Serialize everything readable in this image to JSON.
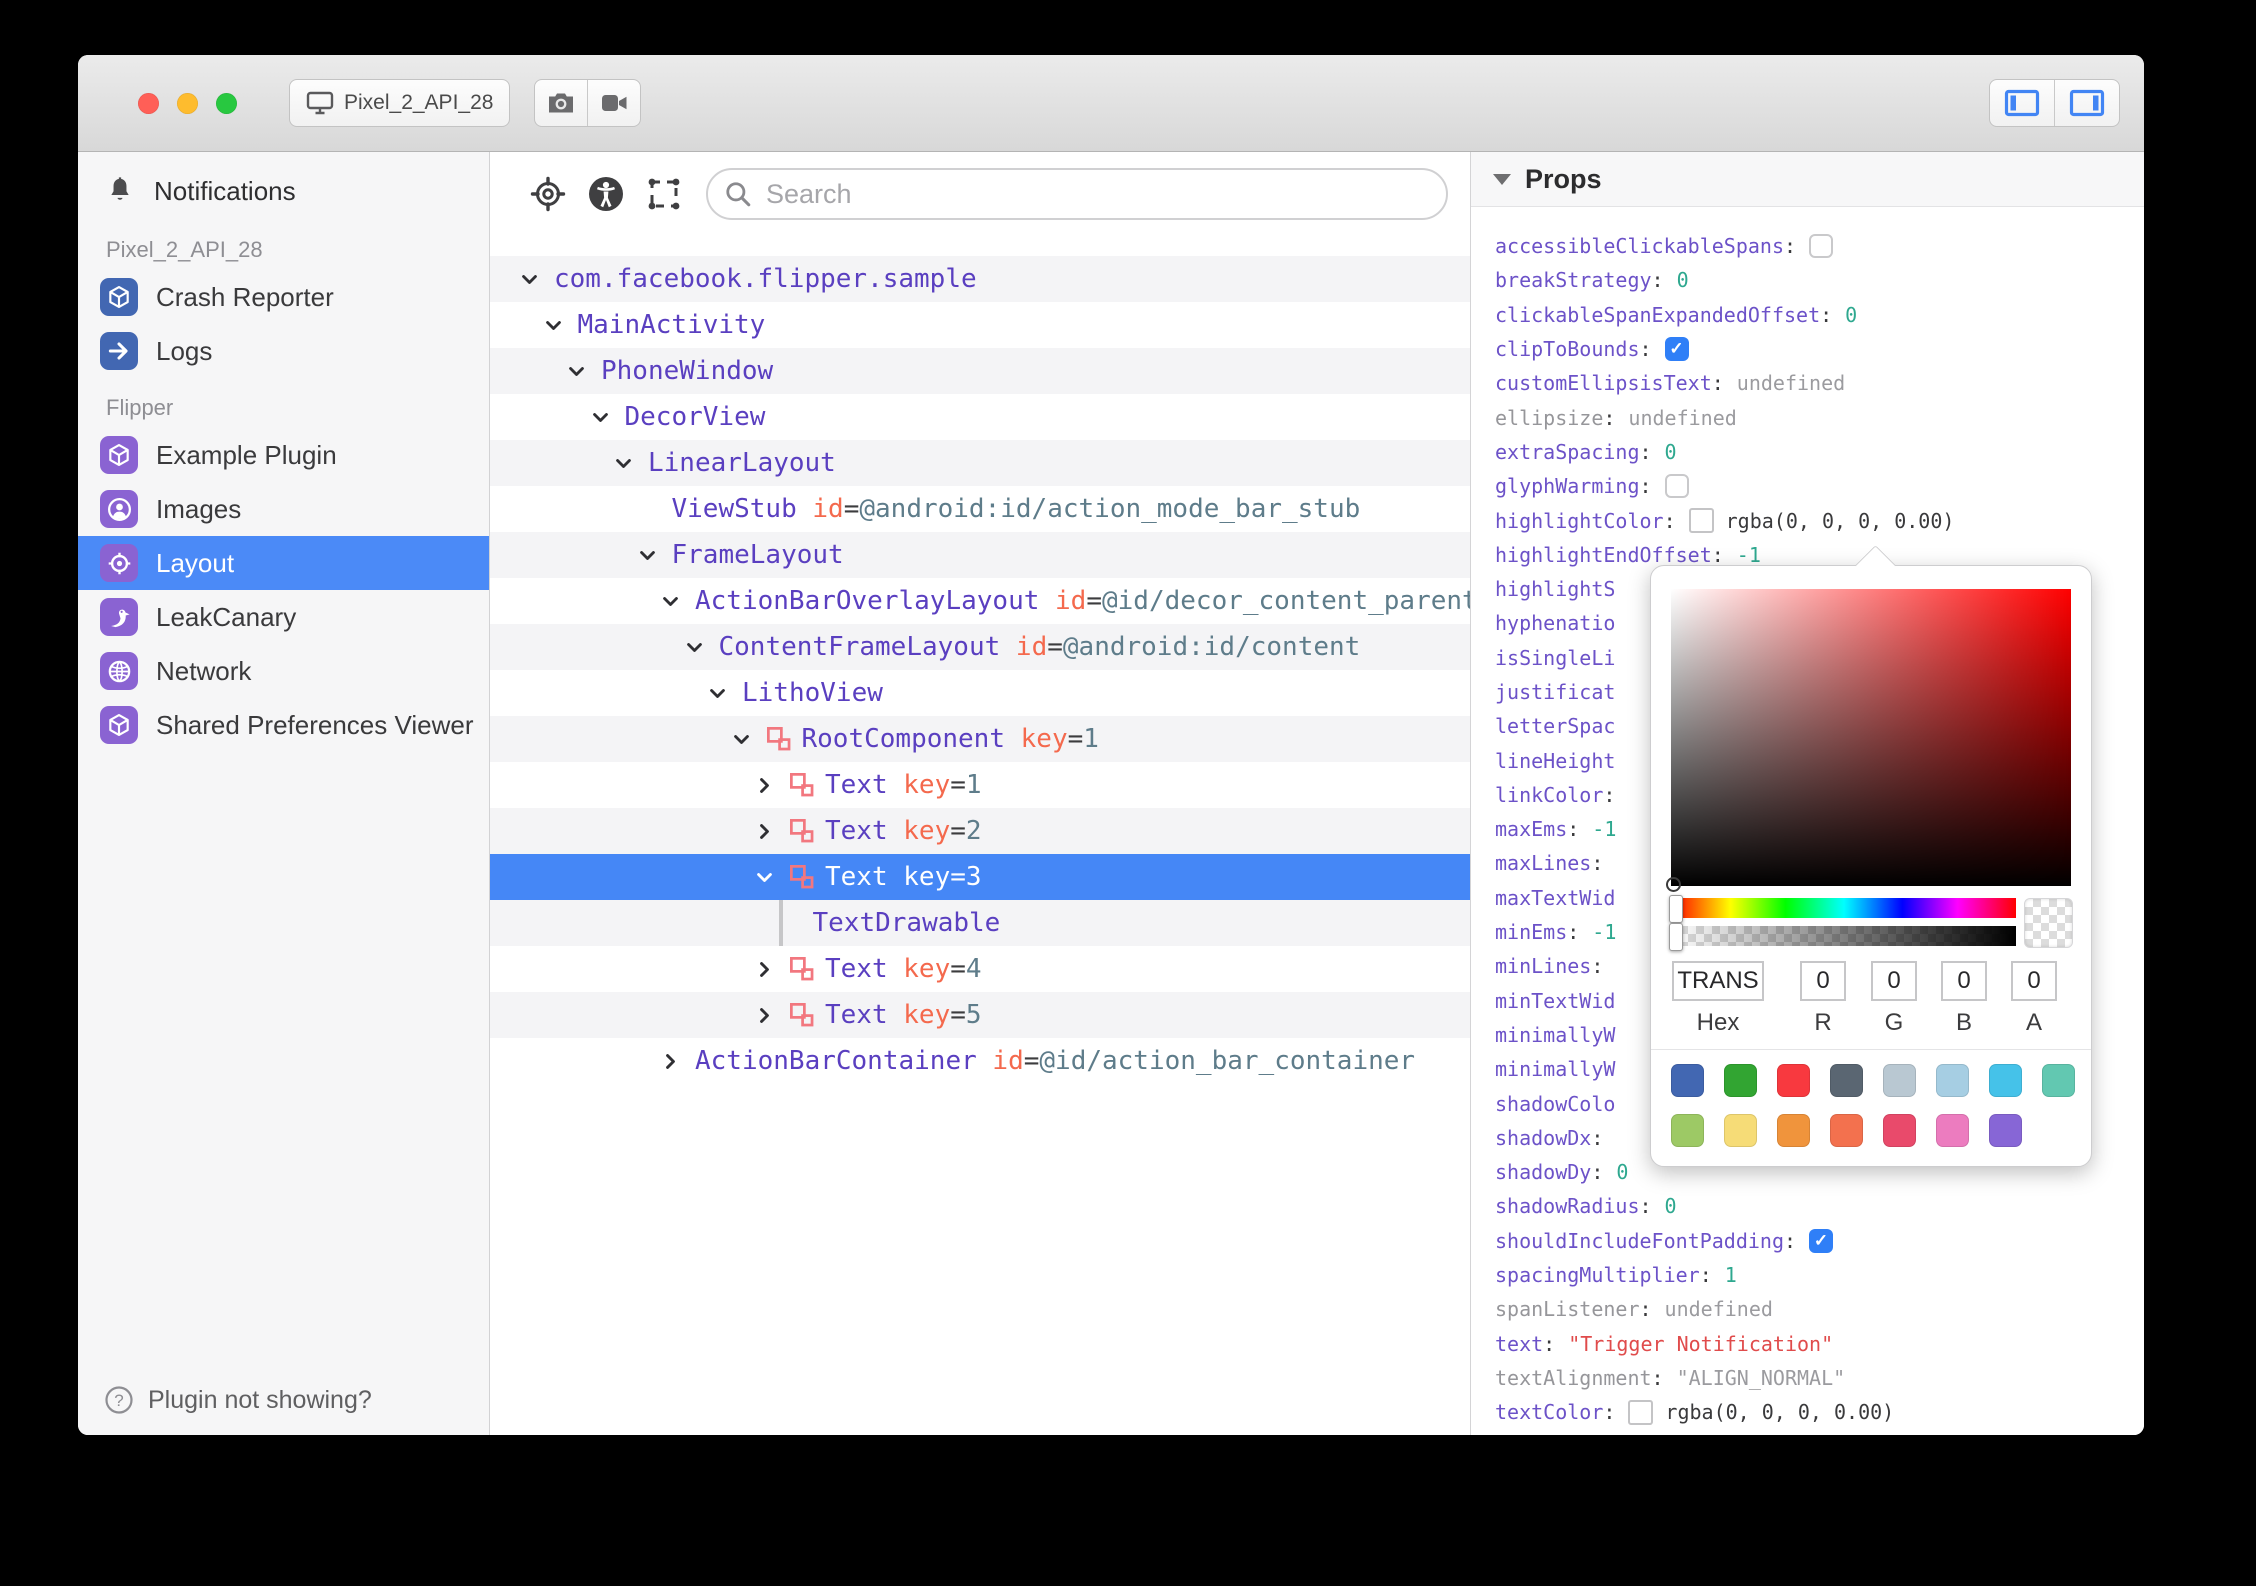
{
  "titlebar": {
    "device": "Pixel_2_API_28"
  },
  "sidebar": {
    "notifications": "Notifications",
    "sections": [
      {
        "header": "Pixel_2_API_28",
        "items": [
          {
            "label": "Crash Reporter",
            "icon": "cube",
            "color": "#4267B2"
          },
          {
            "label": "Logs",
            "icon": "arrow",
            "color": "#4267B2"
          }
        ]
      },
      {
        "header": "Flipper",
        "items": [
          {
            "label": "Example Plugin",
            "icon": "cube",
            "color": "#8A63D2"
          },
          {
            "label": "Images",
            "icon": "person",
            "color": "#8A63D2"
          },
          {
            "label": "Layout",
            "icon": "target",
            "color": "#8A63D2",
            "selected": true
          },
          {
            "label": "LeakCanary",
            "icon": "bird",
            "color": "#8A63D2"
          },
          {
            "label": "Network",
            "icon": "globe",
            "color": "#8A63D2"
          },
          {
            "label": "Shared Preferences Viewer",
            "icon": "cube",
            "color": "#8A63D2"
          }
        ]
      }
    ],
    "help": "Plugin not showing?"
  },
  "toolbar": {
    "search_placeholder": "Search"
  },
  "tree": {
    "rows": [
      {
        "level": 0,
        "chev": "down",
        "name": "com.facebook.flipper.sample"
      },
      {
        "level": 1,
        "chev": "down",
        "name": "MainActivity"
      },
      {
        "level": 2,
        "chev": "down",
        "name": "PhoneWindow"
      },
      {
        "level": 3,
        "chev": "down",
        "name": "DecorView"
      },
      {
        "level": 4,
        "chev": "down",
        "name": "LinearLayout"
      },
      {
        "level": 5,
        "chev": "none",
        "name": "ViewStub",
        "attrs": [
          {
            "n": "id",
            "v": "@android:id/action_mode_bar_stub"
          }
        ]
      },
      {
        "level": 5,
        "chev": "down",
        "name": "FrameLayout"
      },
      {
        "level": 6,
        "chev": "down",
        "name": "ActionBarOverlayLayout",
        "attrs": [
          {
            "n": "id",
            "v": "@id/decor_content_parent"
          }
        ]
      },
      {
        "level": 7,
        "chev": "down",
        "name": "ContentFrameLayout",
        "attrs": [
          {
            "n": "id",
            "v": "@android:id/content"
          }
        ]
      },
      {
        "level": 8,
        "chev": "down",
        "name": "LithoView"
      },
      {
        "level": 9,
        "chev": "down",
        "litho": true,
        "name": "RootComponent",
        "attrs": [
          {
            "n": "key",
            "v": "1"
          }
        ]
      },
      {
        "level": 10,
        "chev": "right",
        "litho": true,
        "name": "Text",
        "attrs": [
          {
            "n": "key",
            "v": "1"
          }
        ]
      },
      {
        "level": 10,
        "chev": "right",
        "litho": true,
        "name": "Text",
        "attrs": [
          {
            "n": "key",
            "v": "2"
          }
        ]
      },
      {
        "level": 10,
        "chev": "down",
        "litho": true,
        "name": "Text",
        "attrs": [
          {
            "n": "key",
            "v": "3"
          }
        ],
        "selected": true
      },
      {
        "level": 11,
        "chev": "bar",
        "name": "TextDrawable"
      },
      {
        "level": 10,
        "chev": "right",
        "litho": true,
        "name": "Text",
        "attrs": [
          {
            "n": "key",
            "v": "4"
          }
        ]
      },
      {
        "level": 10,
        "chev": "right",
        "litho": true,
        "name": "Text",
        "attrs": [
          {
            "n": "key",
            "v": "5"
          }
        ]
      },
      {
        "level": 6,
        "chev": "right",
        "name": "ActionBarContainer",
        "attrs": [
          {
            "n": "id",
            "v": "@id/action_bar_container"
          }
        ]
      }
    ]
  },
  "props": {
    "title": "Props",
    "rows": [
      {
        "key": "accessibleClickableSpans",
        "type": "checkbox",
        "checked": false
      },
      {
        "key": "breakStrategy",
        "type": "number",
        "value": "0"
      },
      {
        "key": "clickableSpanExpandedOffset",
        "type": "number",
        "value": "0"
      },
      {
        "key": "clipToBounds",
        "type": "checkbox",
        "checked": true
      },
      {
        "key": "customEllipsisText",
        "type": "gray",
        "value": "undefined"
      },
      {
        "key": "ellipsize",
        "type": "gray",
        "value": "undefined",
        "grayKey": true
      },
      {
        "key": "extraSpacing",
        "type": "number",
        "value": "0"
      },
      {
        "key": "glyphWarming",
        "type": "checkbox",
        "checked": false
      },
      {
        "key": "highlightColor",
        "type": "color",
        "value": "rgba(0, 0, 0, 0.00)"
      },
      {
        "key": "highlightEndOffset",
        "type": "number",
        "value": "-1"
      },
      {
        "key": "highlightS",
        "type": "trunc"
      },
      {
        "key": "hyphenatio",
        "type": "trunc"
      },
      {
        "key": "isSingleLi",
        "type": "trunc"
      },
      {
        "key": "justificat",
        "type": "trunc"
      },
      {
        "key": "letterSpac",
        "type": "trunc"
      },
      {
        "key": "lineHeight",
        "type": "trunc"
      },
      {
        "key": "linkColor",
        "type": "number",
        "value": ""
      },
      {
        "key": "maxEms",
        "type": "number",
        "value": "-1"
      },
      {
        "key": "maxLines",
        "type": "number",
        "value": ""
      },
      {
        "key": "maxTextWid",
        "type": "trunc"
      },
      {
        "key": "minEms",
        "type": "number",
        "value": "-1"
      },
      {
        "key": "minLines",
        "type": "number",
        "value": ""
      },
      {
        "key": "minTextWid",
        "type": "trunc"
      },
      {
        "key": "minimallyW",
        "type": "trunc"
      },
      {
        "key": "minimallyW",
        "type": "trunc"
      },
      {
        "key": "shadowColo",
        "type": "trunc"
      },
      {
        "key": "shadowDx",
        "type": "number",
        "value": ""
      },
      {
        "key": "shadowDy",
        "type": "number",
        "value": "0"
      },
      {
        "key": "shadowRadius",
        "type": "number",
        "value": "0"
      },
      {
        "key": "shouldIncludeFontPadding",
        "type": "checkbox",
        "checked": true
      },
      {
        "key": "spacingMultiplier",
        "type": "number",
        "value": "1"
      },
      {
        "key": "spanListener",
        "type": "gray",
        "value": "undefined",
        "grayKey": true
      },
      {
        "key": "text",
        "type": "string",
        "value": "\"Trigger Notification\""
      },
      {
        "key": "textAlignment",
        "type": "graystr",
        "value": "\"ALIGN_NORMAL\"",
        "grayKey": true
      },
      {
        "key": "textColor",
        "type": "color",
        "value": "rgba(0, 0, 0, 0.00)"
      }
    ]
  },
  "picker": {
    "hex": "TRANS",
    "r": "0",
    "g": "0",
    "b": "0",
    "a": "0",
    "labels": {
      "hex": "Hex",
      "r": "R",
      "g": "G",
      "b": "B",
      "a": "A"
    },
    "swatches_row1": [
      "#4267B2",
      "#32A532",
      "#F8393F",
      "#5A6672",
      "#B9C8D2",
      "#A6CEE3",
      "#45C2E9",
      "#62C8B1"
    ],
    "swatches_row2": [
      "#9DC965",
      "#F6DC77",
      "#F0943C",
      "#F3714E",
      "#E94A6B",
      "#EC7CBF",
      "#8766D6"
    ]
  },
  "colors": {
    "accent": "#4587F6",
    "selection": "#4B8AF7",
    "checkbox": "#2F7FF7",
    "litho_icon": "#F2777F"
  }
}
